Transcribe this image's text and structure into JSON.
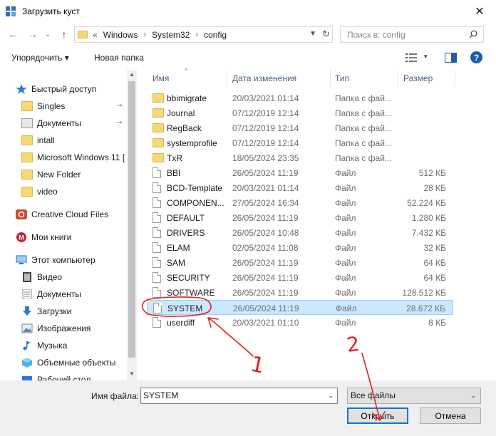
{
  "window": {
    "title": "Загрузить куст",
    "close_glyph": "✕"
  },
  "nav": {
    "back_glyph": "←",
    "forward_glyph": "→",
    "recent_glyph": "⌄",
    "up_glyph": "↑",
    "breadcrumb_more": "«",
    "breadcrumb": [
      "Windows",
      "System32",
      "config"
    ],
    "crumb_separator": "›",
    "search_placeholder": "Поиск в: config"
  },
  "toolbar": {
    "organize": "Упорядочить ▾",
    "new_folder": "Новая папка",
    "views_drop": "▾",
    "help": "?"
  },
  "sidebar": {
    "items": [
      {
        "label": "Быстрый доступ",
        "icon": "star-icon",
        "pinned": false
      },
      {
        "label": "Singles",
        "icon": "folder-icon",
        "pinned": true
      },
      {
        "label": "Документы",
        "icon": "documents-folder-icon",
        "pinned": true
      },
      {
        "label": "intall",
        "icon": "folder-icon",
        "pinned": false
      },
      {
        "label": "Microsoft Windows 11 [",
        "icon": "folder-icon",
        "pinned": false
      },
      {
        "label": "New Folder",
        "icon": "folder-icon",
        "pinned": false
      },
      {
        "label": "video",
        "icon": "folder-icon",
        "pinned": false
      },
      {
        "label": "Creative Cloud Files",
        "icon": "creative-cloud-icon",
        "pinned": false
      },
      {
        "label": "Мои книги",
        "icon": "books-icon",
        "pinned": false
      },
      {
        "label": "Этот компьютер",
        "icon": "computer-icon",
        "pinned": false
      },
      {
        "label": "Видео",
        "icon": "video-folder-icon",
        "pinned": false
      },
      {
        "label": "Документы",
        "icon": "documents-folder-icon",
        "pinned": false
      },
      {
        "label": "Загрузки",
        "icon": "downloads-icon",
        "pinned": false
      },
      {
        "label": "Изображения",
        "icon": "pictures-icon",
        "pinned": false
      },
      {
        "label": "Музыка",
        "icon": "music-icon",
        "pinned": false
      },
      {
        "label": "Объемные объекты",
        "icon": "3d-objects-icon",
        "pinned": false
      },
      {
        "label": "Рабочий стол",
        "icon": "desktop-icon",
        "pinned": false
      }
    ],
    "pin_glyph": "📌"
  },
  "columns": {
    "name": "Имя",
    "date": "Дата изменения",
    "type": "Тип",
    "size": "Размер",
    "sort_glyph": "^"
  },
  "files": [
    {
      "name": "bbimigrate",
      "date": "20/03/2021 01:14",
      "type": "Папка с фай...",
      "size": "",
      "kind": "folder"
    },
    {
      "name": "Journal",
      "date": "07/12/2019 12:14",
      "type": "Папка с фай...",
      "size": "",
      "kind": "folder"
    },
    {
      "name": "RegBack",
      "date": "07/12/2019 12:14",
      "type": "Папка с фай...",
      "size": "",
      "kind": "folder"
    },
    {
      "name": "systemprofile",
      "date": "07/12/2019 12:14",
      "type": "Папка с фай...",
      "size": "",
      "kind": "folder"
    },
    {
      "name": "TxR",
      "date": "18/05/2024 23:35",
      "type": "Папка с фай...",
      "size": "",
      "kind": "folder"
    },
    {
      "name": "BBI",
      "date": "26/05/2024 11:19",
      "type": "Файл",
      "size": "512 КБ",
      "kind": "file"
    },
    {
      "name": "BCD-Template",
      "date": "20/03/2021 01:14",
      "type": "Файл",
      "size": "28 КБ",
      "kind": "file"
    },
    {
      "name": "COMPONEN...",
      "date": "27/05/2024 16:34",
      "type": "Файл",
      "size": "52.224 КБ",
      "kind": "file"
    },
    {
      "name": "DEFAULT",
      "date": "26/05/2024 11:19",
      "type": "Файл",
      "size": "1.280 КБ",
      "kind": "file"
    },
    {
      "name": "DRIVERS",
      "date": "26/05/2024 10:48",
      "type": "Файл",
      "size": "7.432 КБ",
      "kind": "file"
    },
    {
      "name": "ELAM",
      "date": "02/05/2024 11:08",
      "type": "Файл",
      "size": "32 КБ",
      "kind": "file"
    },
    {
      "name": "SAM",
      "date": "26/05/2024 11:19",
      "type": "Файл",
      "size": "64 КБ",
      "kind": "file"
    },
    {
      "name": "SECURITY",
      "date": "26/05/2024 11:19",
      "type": "Файл",
      "size": "64 КБ",
      "kind": "file"
    },
    {
      "name": "SOFTWARE",
      "date": "26/05/2024 11:19",
      "type": "Файл",
      "size": "128.512 КБ",
      "kind": "file"
    },
    {
      "name": "SYSTEM",
      "date": "26/05/2024 11:19",
      "type": "Файл",
      "size": "28.672 КБ",
      "kind": "file",
      "selected": true
    },
    {
      "name": "userdiff",
      "date": "20/03/2021 01:10",
      "type": "Файл",
      "size": "8 КБ",
      "kind": "file"
    }
  ],
  "footer": {
    "filename_label": "Имя файла:",
    "filename_value": "SYSTEM",
    "filetype_value": "Все файлы",
    "open": "Открыть",
    "cancel": "Отмена",
    "drop_glyph": "⌄"
  },
  "annotations": {
    "step1": "1",
    "step2": "2",
    "color": "#e0201c"
  }
}
